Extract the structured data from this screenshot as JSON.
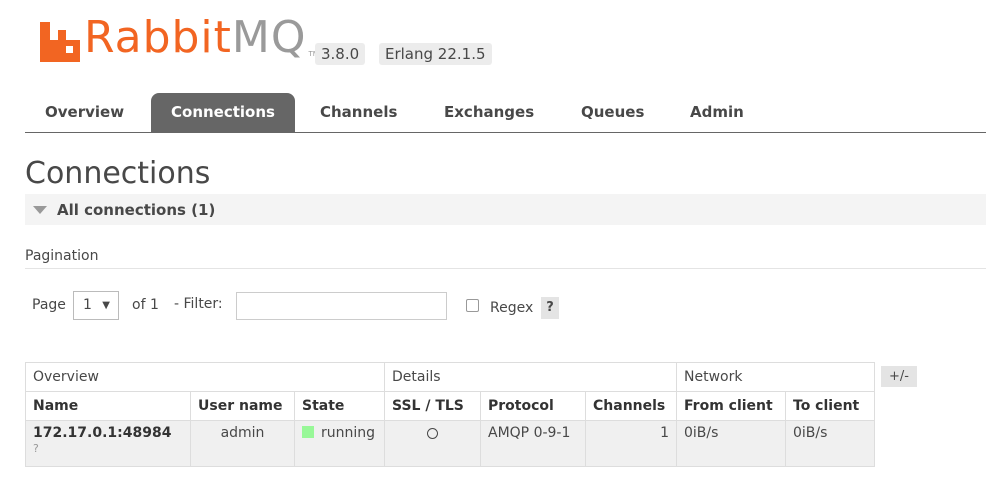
{
  "header": {
    "logo_rabbit": "Rabbit",
    "logo_mq": "MQ",
    "logo_tm": "TM",
    "version": "3.8.0",
    "erlang": "Erlang 22.1.5",
    "colors": {
      "brand": "#f26522",
      "logo_grey": "#9a9a9a"
    }
  },
  "nav": {
    "tabs": [
      {
        "label": "Overview"
      },
      {
        "label": "Connections",
        "active": true
      },
      {
        "label": "Channels"
      },
      {
        "label": "Exchanges"
      },
      {
        "label": "Queues"
      },
      {
        "label": "Admin"
      }
    ]
  },
  "page_title": "Connections",
  "section": {
    "title": "All connections (1)",
    "icon": "collapse-triangle-icon"
  },
  "pagination": {
    "title": "Pagination",
    "page_label": "Page",
    "page_value": "1",
    "of_label": "of 1",
    "filter_label": "- Filter:",
    "filter_value": "",
    "regex_label": "Regex",
    "regex_checked": false,
    "help_label": "?"
  },
  "table": {
    "groups": [
      "Overview",
      "Details",
      "Network"
    ],
    "columns": [
      "Name",
      "User name",
      "State",
      "SSL / TLS",
      "Protocol",
      "Channels",
      "From client",
      "To client"
    ],
    "rows": [
      {
        "name": "172.17.0.1:48984",
        "name_sub": "?",
        "user": "admin",
        "state": "running",
        "ssl_icon": "empty-circle-icon",
        "protocol": "AMQP 0-9-1",
        "channels": "1",
        "from_client": "0iB/s",
        "to_client": "0iB/s"
      }
    ],
    "columns_toggle": "+/-",
    "colors": {
      "state_running": "#98f898"
    }
  }
}
